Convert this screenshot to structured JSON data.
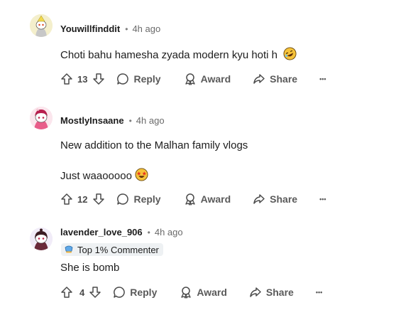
{
  "comments": [
    {
      "author": "Youwillfinddit",
      "time": "4h ago",
      "text": "Choti bahu hamesha zyada modern kyu hoti h",
      "emoji": "rofl-emoji",
      "votes": "13",
      "reply_label": "Reply",
      "award_label": "Award",
      "share_label": "Share",
      "more_label": "•••"
    },
    {
      "author": "MostlyInsaane",
      "time": "4h ago",
      "text": "New addition to the Malhan family vlogs",
      "text2": "Just waaooooo",
      "emoji": "star-struck-emoji",
      "votes": "12",
      "reply_label": "Reply",
      "award_label": "Award",
      "share_label": "Share",
      "more_label": "•••"
    },
    {
      "author": "lavender_love_906",
      "time": "4h ago",
      "badge": "Top 1% Commenter",
      "text": "She is bomb",
      "votes": "4",
      "reply_label": "Reply",
      "award_label": "Award",
      "share_label": "Share",
      "more_label": "•••"
    }
  ],
  "separator": "•",
  "colors": {
    "text": "#1c1c1c",
    "muted": "#6a6a6a",
    "badge_bg": "#eef1f3"
  }
}
